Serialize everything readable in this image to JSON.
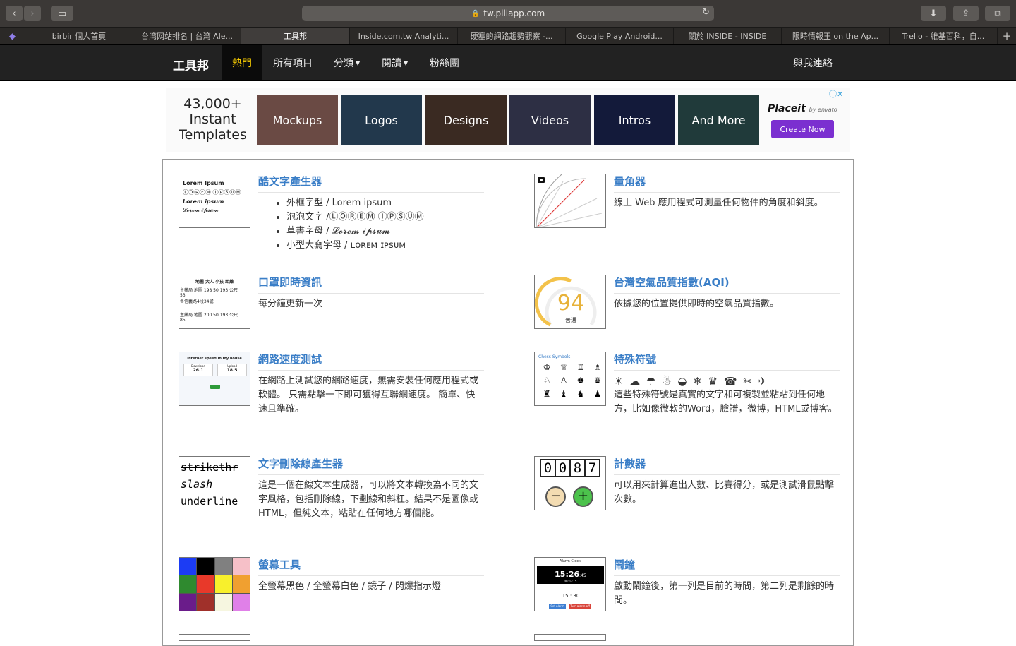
{
  "browser": {
    "url": "tw.piliapp.com",
    "tabs": [
      {
        "label": "birbir 個人首頁"
      },
      {
        "label": "台湾网站排名 | 台湾 Ale..."
      },
      {
        "label": "工具邦",
        "active": true
      },
      {
        "label": "Inside.com.tw Analyti..."
      },
      {
        "label": "硬塞的網路趨勢觀察 -..."
      },
      {
        "label": "Google Play Android..."
      },
      {
        "label": "關於 INSIDE - INSIDE"
      },
      {
        "label": "限時情報王 on the Ap..."
      },
      {
        "label": "Trello - 維基百科，自..."
      }
    ]
  },
  "nav": {
    "brand": "工具邦",
    "items": [
      "熱門",
      "所有項目",
      "分類",
      "閱讀",
      "粉絲團"
    ],
    "contact": "與我連絡"
  },
  "ad": {
    "count_line1": "43,000+",
    "count_line2": "Instant",
    "count_line3": "Templates",
    "tiles": [
      "Mockups",
      "Logos",
      "Designs",
      "Videos",
      "Intros",
      "And More"
    ],
    "tile_colors": [
      "#6a4a44",
      "#22384c",
      "#3a2a22",
      "#2d2f44",
      "#131a3a",
      "#203a3a"
    ],
    "brand": "Placeit",
    "brand_sub": "by envato",
    "cta": "Create Now"
  },
  "cards": [
    {
      "title": "酷文字產生器",
      "bullets": [
        "外框字型 / Lorem ipsum",
        "泡泡文字 /ⓁⓄⓇⒺⓂ ⒾⓅⓈⓊⓂ",
        "草書字母 / 𝓛𝓸𝓻𝓮𝓶 𝓲𝓹𝓼𝓾𝓶",
        "小型大寫字母 / ʟᴏʀᴇᴍ ɪᴘsᴜᴍ"
      ]
    },
    {
      "title": "量角器",
      "desc": "線上 Web 應用程式可測量任何物件的角度和斜度。"
    },
    {
      "title": "口罩即時資訊",
      "desc": "每分鐘更新一次"
    },
    {
      "title": "台灣空氣品質指數(AQI)",
      "desc": "依據您的位置提供即時的空氣品質指數。"
    },
    {
      "title": "網路速度測試",
      "desc": "在網路上測試您的網路速度，無需安裝任何應用程式或軟體。 只需點擊一下即可獲得互聯網速度。 簡單、快速且準確。"
    },
    {
      "title": "特殊符號",
      "glyphs": "☀ ☁ ☂ ☃ ◒ ❅ ♛ ☎ ✂ ✈",
      "desc": "這些特殊符號是真實的文字和可複製並粘貼到任何地方，比如像微軟的Word，臉譜，微博，HTML或博客。"
    },
    {
      "title": "文字刪除線產生器",
      "desc": "這是一個在線文本生成器，可以將文本轉換為不同的文字風格，包括刪除線，下劃線和斜杠。結果不是圖像或HTML，但純文本，粘貼在任何地方哪個能。"
    },
    {
      "title": "計數器",
      "desc": "可以用來計算進出人數、比賽得分，或是測試滑鼠點擊次數。"
    },
    {
      "title": "螢幕工具",
      "desc": "全螢幕黑色 / 全螢幕白色 / 鏡子 / 閃爍指示燈"
    },
    {
      "title": "鬧鐘",
      "desc": "啟動鬧鐘後，第一列是目前的時間，第二列是剩餘的時間。"
    }
  ],
  "thumbs": {
    "cooltext": [
      "Lorem Ipsum",
      "ⓁⓄⓇⒺⓂ ⒾⓅⓈⓊⓂ",
      "Lorem ipsum",
      "𝓛𝓸𝓻𝓮𝓶 𝓲𝓹𝓼𝓾𝓶"
    ],
    "mask_header": "地圖 大人 小孩   距離",
    "mask_rows": [
      "主藥局  地圖  198  50  193 公尺",
      "53",
      "各信義路4段34號",
      "主藥局  地圖  200  50  193 公尺",
      "85"
    ],
    "aqi_value": "94",
    "aqi_label": "普通",
    "speed_title": "Internet speed in my house",
    "speed_dl_label": "Download",
    "speed_dl": "26.1",
    "speed_ul_label": "Upload",
    "speed_ul": "18.5",
    "chess_title": "Chess Symbols",
    "chess": [
      "♔",
      "♕",
      "♖",
      "♗",
      "♘",
      "♙",
      "♚",
      "♛",
      "♜",
      "♝",
      "♞",
      "♟"
    ],
    "strike": [
      "strikethr",
      "slash",
      "underline"
    ],
    "counter": [
      "0",
      "0",
      "8",
      "7"
    ],
    "counter_minus": "−",
    "counter_plus": "+",
    "screen_colors": [
      "#1c3cf4",
      "#000000",
      "#808080",
      "#f6c0c8",
      "#2f8a2f",
      "#e8392a",
      "#f8f02c",
      "#f0a030",
      "#6a1c8a",
      "#a0302a",
      "#f6f6e0",
      "#e080e8"
    ],
    "alarm_title": "Alarm Clock",
    "alarm_time": "15:26",
    "alarm_sec": ":45",
    "alarm_sub": "00:03:15",
    "alarm_set": "15  :  30",
    "alarm_btn1": "Set alarm",
    "alarm_btn2": "Turn alarm off"
  }
}
